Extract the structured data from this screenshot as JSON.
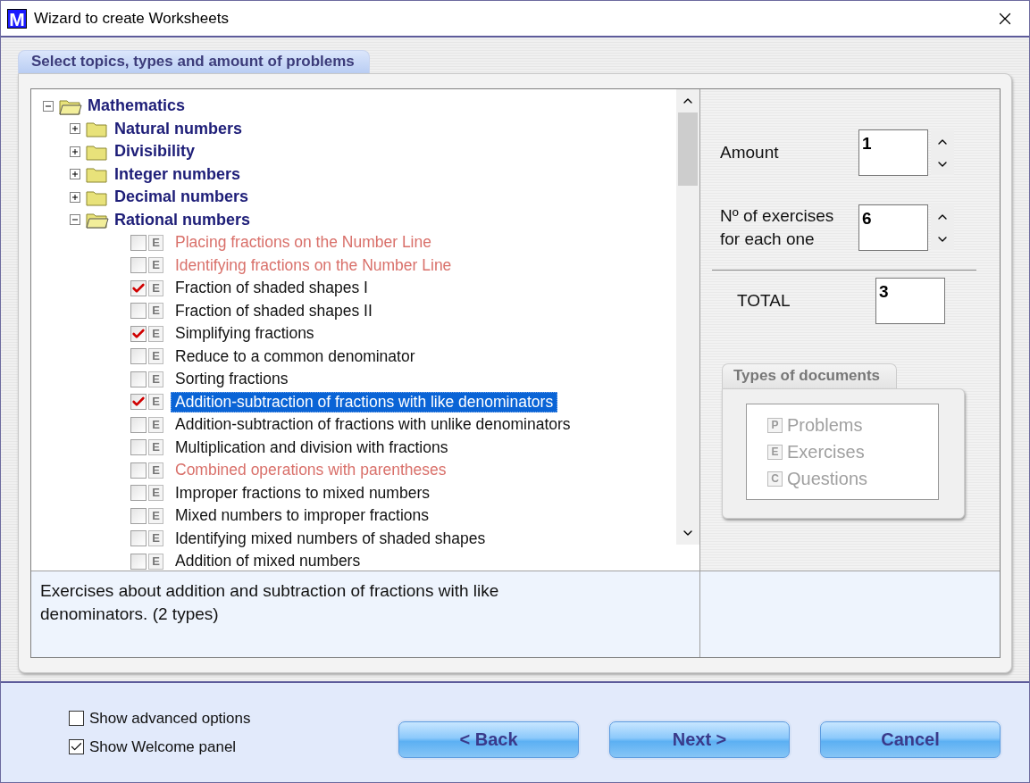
{
  "window": {
    "title": "Wizard to create Worksheets",
    "app_icon_letter": "M"
  },
  "tab": {
    "label": "Select topics, types and amount of problems"
  },
  "tree": {
    "expanded": true,
    "label": "Mathematics",
    "children": [
      {
        "kind": "folder",
        "label": "Natural numbers",
        "expanded": false
      },
      {
        "kind": "folder",
        "label": "Divisibility",
        "expanded": false
      },
      {
        "kind": "folder",
        "label": "Integer numbers",
        "expanded": false
      },
      {
        "kind": "folder",
        "label": "Decimal numbers",
        "expanded": false
      },
      {
        "kind": "folder",
        "label": "Rational numbers",
        "expanded": true,
        "children": [
          {
            "kind": "leaf",
            "type_letter": "E",
            "label": "Placing fractions on the Number Line",
            "checked": false,
            "locked": true,
            "selected": false
          },
          {
            "kind": "leaf",
            "type_letter": "E",
            "label": "Identifying fractions on the Number Line",
            "checked": false,
            "locked": true,
            "selected": false
          },
          {
            "kind": "leaf",
            "type_letter": "E",
            "label": "Fraction of shaded shapes I",
            "checked": true,
            "locked": false,
            "selected": false
          },
          {
            "kind": "leaf",
            "type_letter": "E",
            "label": "Fraction of shaded shapes II",
            "checked": false,
            "locked": false,
            "selected": false
          },
          {
            "kind": "leaf",
            "type_letter": "E",
            "label": "Simplifying fractions",
            "checked": true,
            "locked": false,
            "selected": false
          },
          {
            "kind": "leaf",
            "type_letter": "E",
            "label": "Reduce to a common denominator",
            "checked": false,
            "locked": false,
            "selected": false
          },
          {
            "kind": "leaf",
            "type_letter": "E",
            "label": "Sorting fractions",
            "checked": false,
            "locked": false,
            "selected": false
          },
          {
            "kind": "leaf",
            "type_letter": "E",
            "label": "Addition-subtraction of fractions with like denominators",
            "checked": true,
            "locked": false,
            "selected": true
          },
          {
            "kind": "leaf",
            "type_letter": "E",
            "label": "Addition-subtraction of fractions with unlike denominators",
            "checked": false,
            "locked": false,
            "selected": false
          },
          {
            "kind": "leaf",
            "type_letter": "E",
            "label": "Multiplication and division with fractions",
            "checked": false,
            "locked": false,
            "selected": false
          },
          {
            "kind": "leaf",
            "type_letter": "E",
            "label": "Combined operations with parentheses",
            "checked": false,
            "locked": true,
            "selected": false
          },
          {
            "kind": "leaf",
            "type_letter": "E",
            "label": "Improper fractions to mixed numbers",
            "checked": false,
            "locked": false,
            "selected": false
          },
          {
            "kind": "leaf",
            "type_letter": "E",
            "label": "Mixed numbers to improper fractions",
            "checked": false,
            "locked": false,
            "selected": false
          },
          {
            "kind": "leaf",
            "type_letter": "E",
            "label": "Identifying mixed numbers of shaded shapes",
            "checked": false,
            "locked": false,
            "selected": false
          },
          {
            "kind": "leaf",
            "type_letter": "E",
            "label": "Addition of mixed numbers",
            "checked": false,
            "locked": false,
            "selected": false
          }
        ]
      }
    ]
  },
  "settings": {
    "amount": {
      "label": "Amount",
      "value": "1"
    },
    "exercises_each": {
      "label": "Nº of exercises for each one",
      "value": "6"
    },
    "total": {
      "label": "TOTAL",
      "value": "3"
    }
  },
  "document_types": {
    "title": "Types of documents",
    "disabled": true,
    "items": [
      {
        "letter": "P",
        "label": "Problems"
      },
      {
        "letter": "E",
        "label": "Exercises"
      },
      {
        "letter": "C",
        "label": "Questions"
      }
    ]
  },
  "description": "Exercises about addition and subtraction of fractions with like denominators. (2 types)",
  "options": [
    {
      "label": "Show advanced options",
      "checked": false
    },
    {
      "label": "Show Welcome panel",
      "checked": true
    }
  ],
  "buttons": [
    "< Back",
    "Next >",
    "Cancel"
  ]
}
